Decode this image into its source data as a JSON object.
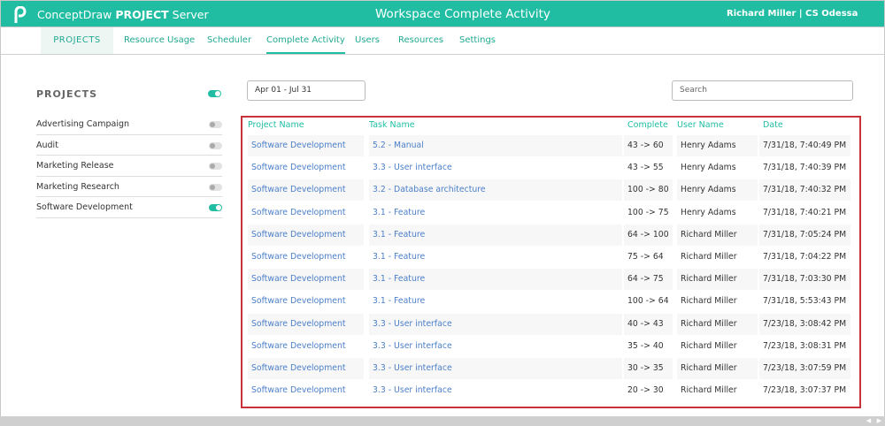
{
  "header": {
    "brand_prefix": "ConceptDraw",
    "brand_bold": "PROJECT",
    "brand_suffix": "Server",
    "title": "Workspace Complete Activity",
    "user": "Richard Miller | CS Odessa"
  },
  "nav": {
    "items": [
      "PROJECTS",
      "Resource Usage",
      "Scheduler",
      "Complete Activity",
      "Users",
      "Resources",
      "Settings"
    ],
    "active": "Complete Activity"
  },
  "sidebar": {
    "title": "PROJECTS",
    "all_on": true,
    "projects": [
      {
        "name": "Advertising Campaign",
        "on": false
      },
      {
        "name": "Audit",
        "on": false
      },
      {
        "name": "Marketing Release",
        "on": false
      },
      {
        "name": "Marketing Research",
        "on": false
      },
      {
        "name": "Software Development",
        "on": true
      }
    ]
  },
  "filters": {
    "date_range": "Apr 01 - Jul 31",
    "search_placeholder": "Search"
  },
  "table": {
    "columns": [
      "Project Name",
      "Task Name",
      "Complete",
      "User Name",
      "Date"
    ],
    "rows": [
      [
        "Software Development",
        "5.2 - Manual",
        "43 -> 60",
        "Henry Adams",
        "7/31/18, 7:40:49 PM"
      ],
      [
        "Software Development",
        "3.3 - User interface",
        "43 -> 55",
        "Henry Adams",
        "7/31/18, 7:40:39 PM"
      ],
      [
        "Software Development",
        "3.2 - Database architecture",
        "100 -> 80",
        "Henry Adams",
        "7/31/18, 7:40:32 PM"
      ],
      [
        "Software Development",
        "3.1 - Feature",
        "100 -> 75",
        "Henry Adams",
        "7/31/18, 7:40:21 PM"
      ],
      [
        "Software Development",
        "3.1 - Feature",
        "64 -> 100",
        "Richard Miller",
        "7/31/18, 7:05:24 PM"
      ],
      [
        "Software Development",
        "3.1 - Feature",
        "75 -> 64",
        "Richard Miller",
        "7/31/18, 7:04:22 PM"
      ],
      [
        "Software Development",
        "3.1 - Feature",
        "64 -> 75",
        "Richard Miller",
        "7/31/18, 7:03:30 PM"
      ],
      [
        "Software Development",
        "3.1 - Feature",
        "100 -> 64",
        "Richard Miller",
        "7/31/18, 5:53:43 PM"
      ],
      [
        "Software Development",
        "3.3 - User interface",
        "40 -> 43",
        "Richard Miller",
        "7/23/18, 3:08:42 PM"
      ],
      [
        "Software Development",
        "3.3 - User interface",
        "35 -> 40",
        "Richard Miller",
        "7/23/18, 3:08:31 PM"
      ],
      [
        "Software Development",
        "3.3 - User interface",
        "30 -> 35",
        "Richard Miller",
        "7/23/18, 3:07:59 PM"
      ],
      [
        "Software Development",
        "3.3 - User interface",
        "20 -> 30",
        "Richard Miller",
        "7/23/18, 3:07:37 PM"
      ]
    ]
  },
  "colors": {
    "accent": "#20bda3",
    "link": "#4b7fc8",
    "highlight": "#c8323a"
  }
}
